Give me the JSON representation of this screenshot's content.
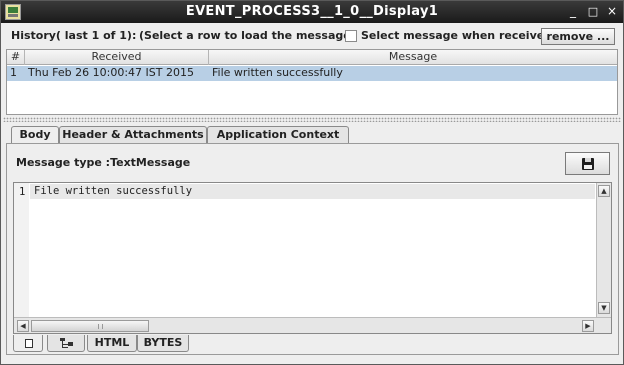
{
  "window": {
    "title": "EVENT_PROCESS3__1_0__Display1",
    "minimize_glyph": "_",
    "maximize_glyph": "□",
    "close_glyph": "×"
  },
  "history": {
    "label": "History( last 1 of 1):",
    "hint": "(Select a row to load the message)",
    "select_when_received_label": "Select message when received",
    "select_when_received_checked": false,
    "remove_button_label": "remove ..."
  },
  "table": {
    "columns": [
      "#",
      "Received",
      "Message"
    ],
    "rows": [
      {
        "num": "1",
        "received": "Thu Feb 26 10:00:47 IST 2015",
        "message": "File written successfully"
      }
    ]
  },
  "tabs": {
    "items": [
      "Body",
      "Header & Attachments",
      "Application Context"
    ],
    "selected": "Body"
  },
  "body": {
    "message_type": "Message type :TextMessage",
    "save_icon": "floppy-disk-icon",
    "lines": [
      {
        "num": "1",
        "text": "File written successfully"
      }
    ]
  },
  "bottom_tabs": {
    "items": [
      "HTML",
      "BYTES"
    ],
    "icons": [
      "document-icon",
      "tree-icon"
    ]
  },
  "colors": {
    "titlebar": "#1f1f1f",
    "selected_row": "#b8cfe5",
    "window_bg": "#eeeeee"
  }
}
